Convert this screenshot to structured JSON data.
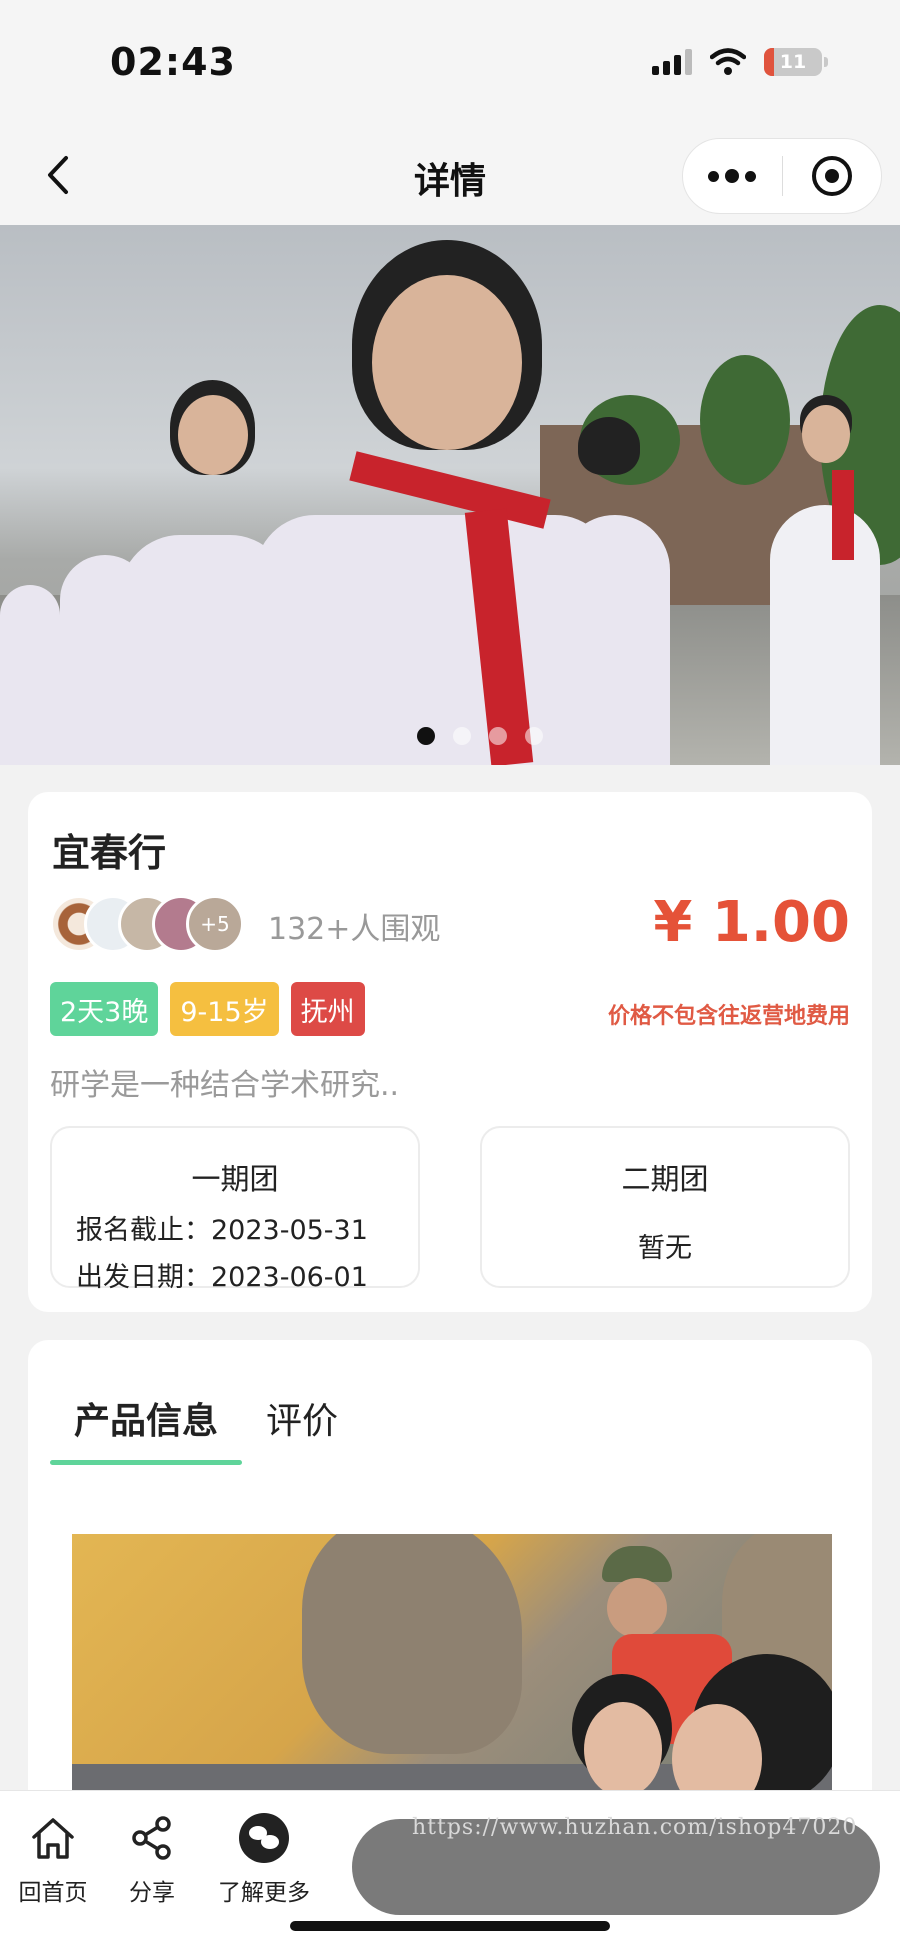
{
  "status_bar": {
    "time": "02:43",
    "battery": "11"
  },
  "nav": {
    "title": "详情"
  },
  "carousel": {
    "page_count": 4,
    "active_index": 0
  },
  "trip": {
    "title": "宜春行",
    "extra_avatars": "+5",
    "viewers": "132+人围观",
    "price": "¥ 1.00",
    "tags": [
      "2天3晚",
      "9-15岁",
      "抚州"
    ],
    "price_note": "价格不包含往返营地费用",
    "description": "研学是一种结合学术研究..",
    "sessions": [
      {
        "name": "一期团",
        "deadline": "报名截止：2023-05-31",
        "departure": "出发日期：2023-06-01"
      },
      {
        "name": "二期团",
        "status": "暂无"
      }
    ]
  },
  "tabs": {
    "product": "产品信息",
    "review": "评价",
    "active": "product"
  },
  "bottom_bar": {
    "home": "回首页",
    "share": "分享",
    "more": "了解更多"
  },
  "watermark": "https://www.huzhan.com/ishop47020",
  "colors": {
    "price": "#e55238",
    "tag_green": "#5fd49a",
    "tag_yellow": "#f5bf40",
    "tag_red": "#dd4a46",
    "tab_underline": "#5fd49a"
  }
}
